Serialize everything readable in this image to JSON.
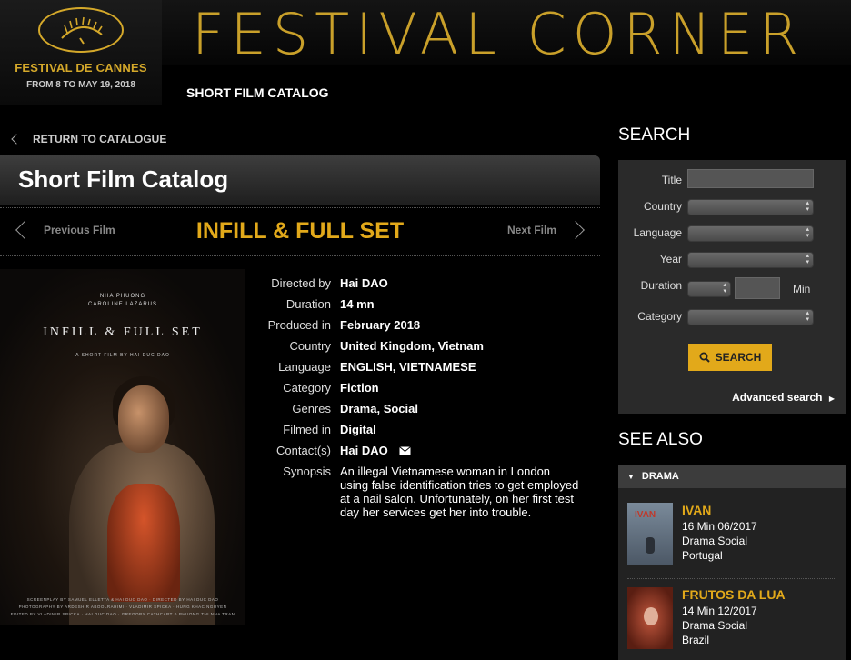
{
  "festival": {
    "name": "FESTIVAL DE CANNES",
    "dates": "FROM 8 TO MAY 19, 2018",
    "section_title": "FESTIVAL CORNER",
    "subnav": "SHORT FILM CATALOG"
  },
  "navigation": {
    "return_label": "RETURN TO CATALOGUE",
    "catalog_heading": "Short Film Catalog",
    "prev_label": "Previous Film",
    "next_label": "Next Film"
  },
  "film": {
    "title": "INFILL & FULL SET",
    "poster": {
      "credit_top": "NHA PHUONG\nCAROLINE LAZARUS",
      "title": "INFILL & FULL SET",
      "subtitle": "A SHORT FILM BY HAI DUC DAO",
      "credit_bottom": "SCREENPLAY BY SAMUEL ELLETTA & HAI DUC DAO · DIRECTED BY HAI DUC DAO\nPHOTOGRAPHY BY ARDESHIR ABOOLRAHIMI · VLADIMIR SPICKA · HUNG KHAC NGUYEN\nEDITED BY VLADIMIR SPICKA · HAI DUC DAO · GREGORY CATHCART & PHUONG THI NHA TRAN"
    },
    "details": [
      {
        "label": "Directed by",
        "value": "Hai DAO"
      },
      {
        "label": "Duration",
        "value": "14 mn"
      },
      {
        "label": "Produced in",
        "value": "February 2018"
      },
      {
        "label": "Country",
        "value": "United Kingdom, Vietnam"
      },
      {
        "label": "Language",
        "value": "ENGLISH, VIETNAMESE"
      },
      {
        "label": "Category",
        "value": "Fiction"
      },
      {
        "label": "Genres",
        "value": "Drama, Social"
      },
      {
        "label": "Filmed in",
        "value": "Digital"
      },
      {
        "label": "Contact(s)",
        "value": "Hai DAO"
      }
    ],
    "synopsis_label": "Synopsis",
    "synopsis": "An illegal Vietnamese woman in London using false identification tries to get employed at a nail salon. Unfortunately, on her first test day her services get her into trouble."
  },
  "search": {
    "heading": "SEARCH",
    "labels": {
      "title": "Title",
      "country": "Country",
      "language": "Language",
      "year": "Year",
      "duration": "Duration",
      "duration_unit": "Min",
      "category": "Category"
    },
    "values": {
      "title": "",
      "country": "",
      "language": "",
      "year": "",
      "duration_select": "",
      "duration_min": "",
      "category": ""
    },
    "button_label": "SEARCH",
    "advanced_label": "Advanced search"
  },
  "see_also": {
    "heading": "SEE ALSO",
    "group": "DRAMA",
    "items": [
      {
        "title": "IVAN",
        "meta": "16 Min 06/2017",
        "genres": "Drama Social",
        "country": "Portugal",
        "thumb_text": "IVAN"
      },
      {
        "title": "FRUTOS DA LUA",
        "meta": "14 Min 12/2017",
        "genres": "Drama Social",
        "country": "Brazil"
      }
    ]
  },
  "colors": {
    "accent": "#e2a91a",
    "gold": "#c9a02a",
    "panel": "#2a2a2a"
  }
}
